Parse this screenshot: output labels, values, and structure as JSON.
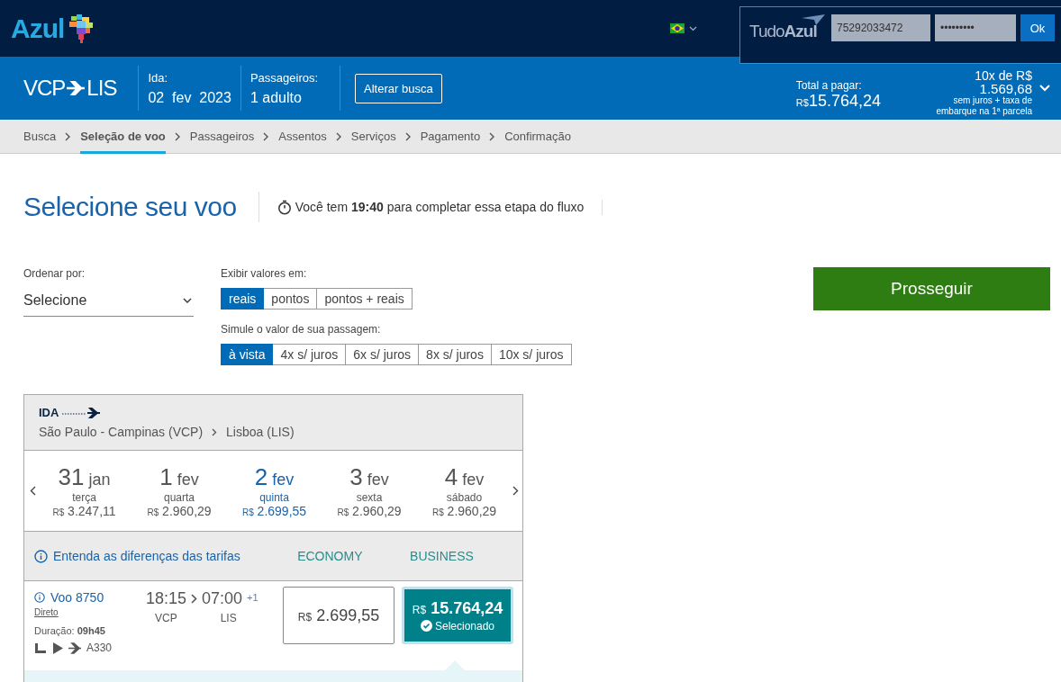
{
  "header": {
    "logo": "Azul",
    "login": {
      "brand": "Tudo**Azul**",
      "username": "75292033472",
      "password": "•••••••••",
      "button": "Ok"
    }
  },
  "summary": {
    "origin": "VCP",
    "destination": "LIS",
    "date_label": "Ida:",
    "date": "02  fev  2023",
    "passengers_label": "Passageiros:",
    "passengers": "1 adulto",
    "change_button": "Alterar busca",
    "total_label": "Total a pagar:",
    "total_currency": "R$",
    "total": "15.764,24",
    "installments_head": "10x de R$",
    "installments_value": "1.569,68",
    "installments_note": "sem juros + taxa de embarque na 1ª parcela"
  },
  "steps": [
    {
      "label": "Busca",
      "selected": false
    },
    {
      "label": "Seleção de voo",
      "selected": true
    },
    {
      "label": "Passageiros",
      "selected": false
    },
    {
      "label": "Assentos",
      "selected": false
    },
    {
      "label": "Serviços",
      "selected": false
    },
    {
      "label": "Pagamento",
      "selected": false
    },
    {
      "label": "Confirmação",
      "selected": false
    }
  ],
  "title": "Selecione seu voo",
  "timer": "Você tem **19:40** para completar essa etapa do fluxo",
  "sort": {
    "label": "Ordenar por:",
    "value": "Selecione"
  },
  "display": {
    "label": "Exibir valores em:",
    "options": [
      {
        "label": "reais",
        "selected": true
      },
      {
        "label": "pontos",
        "selected": false
      },
      {
        "label": "pontos + reais",
        "selected": false
      }
    ]
  },
  "simulate": {
    "label": "Simule o valor de sua passagem:",
    "options": [
      {
        "label": "à vista",
        "selected": true
      },
      {
        "label": "4x s/ juros",
        "selected": false
      },
      {
        "label": "6x s/ juros",
        "selected": false
      },
      {
        "label": "8x s/ juros",
        "selected": false
      },
      {
        "label": "10x s/ juros",
        "selected": false
      }
    ]
  },
  "proceed_button": "Prosseguir",
  "flight_card": {
    "direction": "IDA",
    "origin": "São Paulo - Campinas (VCP)",
    "destination": "Lisboa (LIS)",
    "dates": [
      {
        "day": "31",
        "month": "jan",
        "weekday": "terça",
        "currency": "R$",
        "price": "3.247,11",
        "selected": false
      },
      {
        "day": "1",
        "month": "fev",
        "weekday": "quarta",
        "currency": "R$",
        "price": "2.960,29",
        "selected": false
      },
      {
        "day": "2",
        "month": "fev",
        "weekday": "quinta",
        "currency": "R$",
        "price": "2.699,55",
        "selected": true
      },
      {
        "day": "3",
        "month": "fev",
        "weekday": "sexta",
        "currency": "R$",
        "price": "2.960,29",
        "selected": false
      },
      {
        "day": "4",
        "month": "fev",
        "weekday": "sábado",
        "currency": "R$",
        "price": "2.960,29",
        "selected": false
      }
    ],
    "fare_info_link": "Entenda as diferenças das tarifas",
    "fare_columns": [
      "ECONOMY",
      "BUSINESS"
    ],
    "flight": {
      "number": "Voo 8750",
      "stops": "Direto",
      "departure": "18:15",
      "arrival": "07:00",
      "day_offset": "+1",
      "from": "VCP",
      "to": "LIS",
      "duration": "Duração: **09h45**",
      "aircraft": "A330"
    },
    "fares": [
      {
        "currency": "R$",
        "price": "2.699,55",
        "selected": false
      },
      {
        "currency": "R$",
        "price": "15.764,24",
        "selected": true,
        "status": "Selecionado"
      }
    ]
  }
}
